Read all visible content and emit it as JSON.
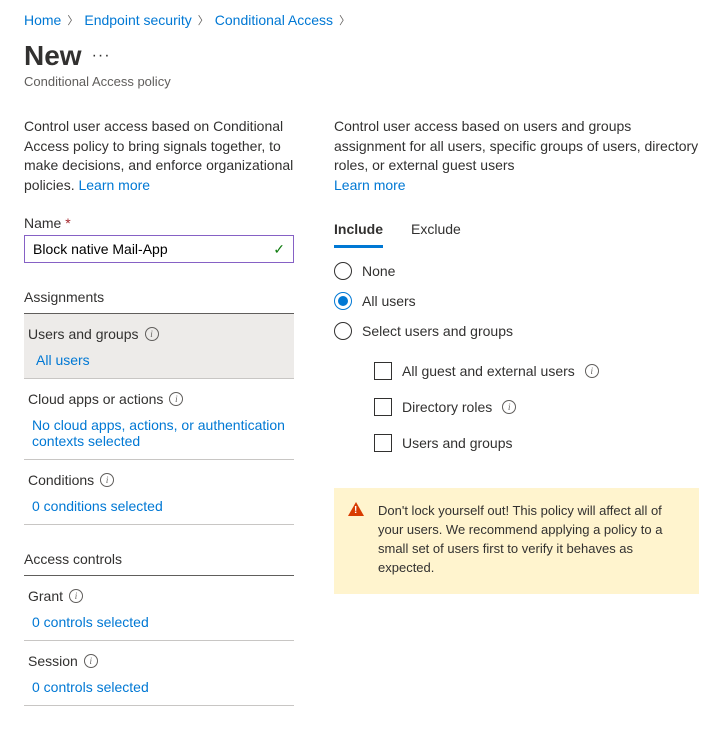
{
  "breadcrumb": [
    {
      "label": "Home"
    },
    {
      "label": "Endpoint security"
    },
    {
      "label": "Conditional Access"
    }
  ],
  "page": {
    "title": "New",
    "more": "···",
    "subtitle": "Conditional Access policy"
  },
  "left": {
    "description": "Control user access based on Conditional Access policy to bring signals together, to make decisions, and enforce organizational policies. ",
    "learn": "Learn more",
    "name_label": "Name ",
    "name_value": "Block native Mail-App",
    "assignments_header": "Assignments",
    "items": [
      {
        "title": "Users and groups",
        "value": "All users",
        "selected": true
      },
      {
        "title": "Cloud apps or actions",
        "value": "No cloud apps, actions, or authentication contexts selected",
        "selected": false
      },
      {
        "title": "Conditions",
        "value": "0 conditions selected",
        "selected": false
      }
    ],
    "controls_header": "Access controls",
    "controls": [
      {
        "title": "Grant",
        "value": "0 controls selected"
      },
      {
        "title": "Session",
        "value": "0 controls selected"
      }
    ]
  },
  "right": {
    "description": "Control user access based on users and groups assignment for all users, specific groups of users, directory roles, or external guest users ",
    "learn": "Learn more",
    "tabs": [
      {
        "label": "Include",
        "active": true
      },
      {
        "label": "Exclude",
        "active": false
      }
    ],
    "radios": [
      {
        "label": "None",
        "checked": false
      },
      {
        "label": "All users",
        "checked": true
      },
      {
        "label": "Select users and groups",
        "checked": false
      }
    ],
    "checks": [
      {
        "label": "All guest and external users",
        "info": true
      },
      {
        "label": "Directory roles",
        "info": true
      },
      {
        "label": "Users and groups",
        "info": false
      }
    ],
    "warning": "Don't lock yourself out! This policy will affect all of your users. We recommend applying a policy to a small set of users first to verify it behaves as expected."
  }
}
